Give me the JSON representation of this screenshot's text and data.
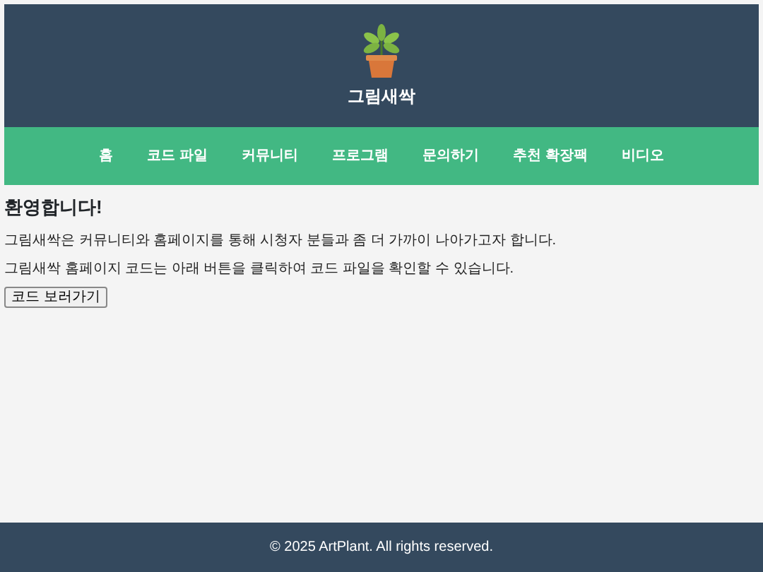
{
  "header": {
    "title": "그림새싹"
  },
  "nav": [
    {
      "label": "홈"
    },
    {
      "label": "코드 파일"
    },
    {
      "label": "커뮤니티"
    },
    {
      "label": "프로그램"
    },
    {
      "label": "문의하기"
    },
    {
      "label": "추천 확장팩"
    },
    {
      "label": "비디오"
    }
  ],
  "main": {
    "heading": "환영합니다!",
    "paragraphs": [
      "그림새싹은 커뮤니티와 홈페이지를 통해 시청자 분들과 좀 더 가까이 나아가고자 합니다.",
      "그림새싹 홈페이지 코드는 아래 버튼을 클릭하여 코드 파일을 확인할 수 있습니다."
    ],
    "button": "코드 보러가기"
  },
  "footer": {
    "text": "© 2025 ArtPlant. All rights reserved."
  }
}
